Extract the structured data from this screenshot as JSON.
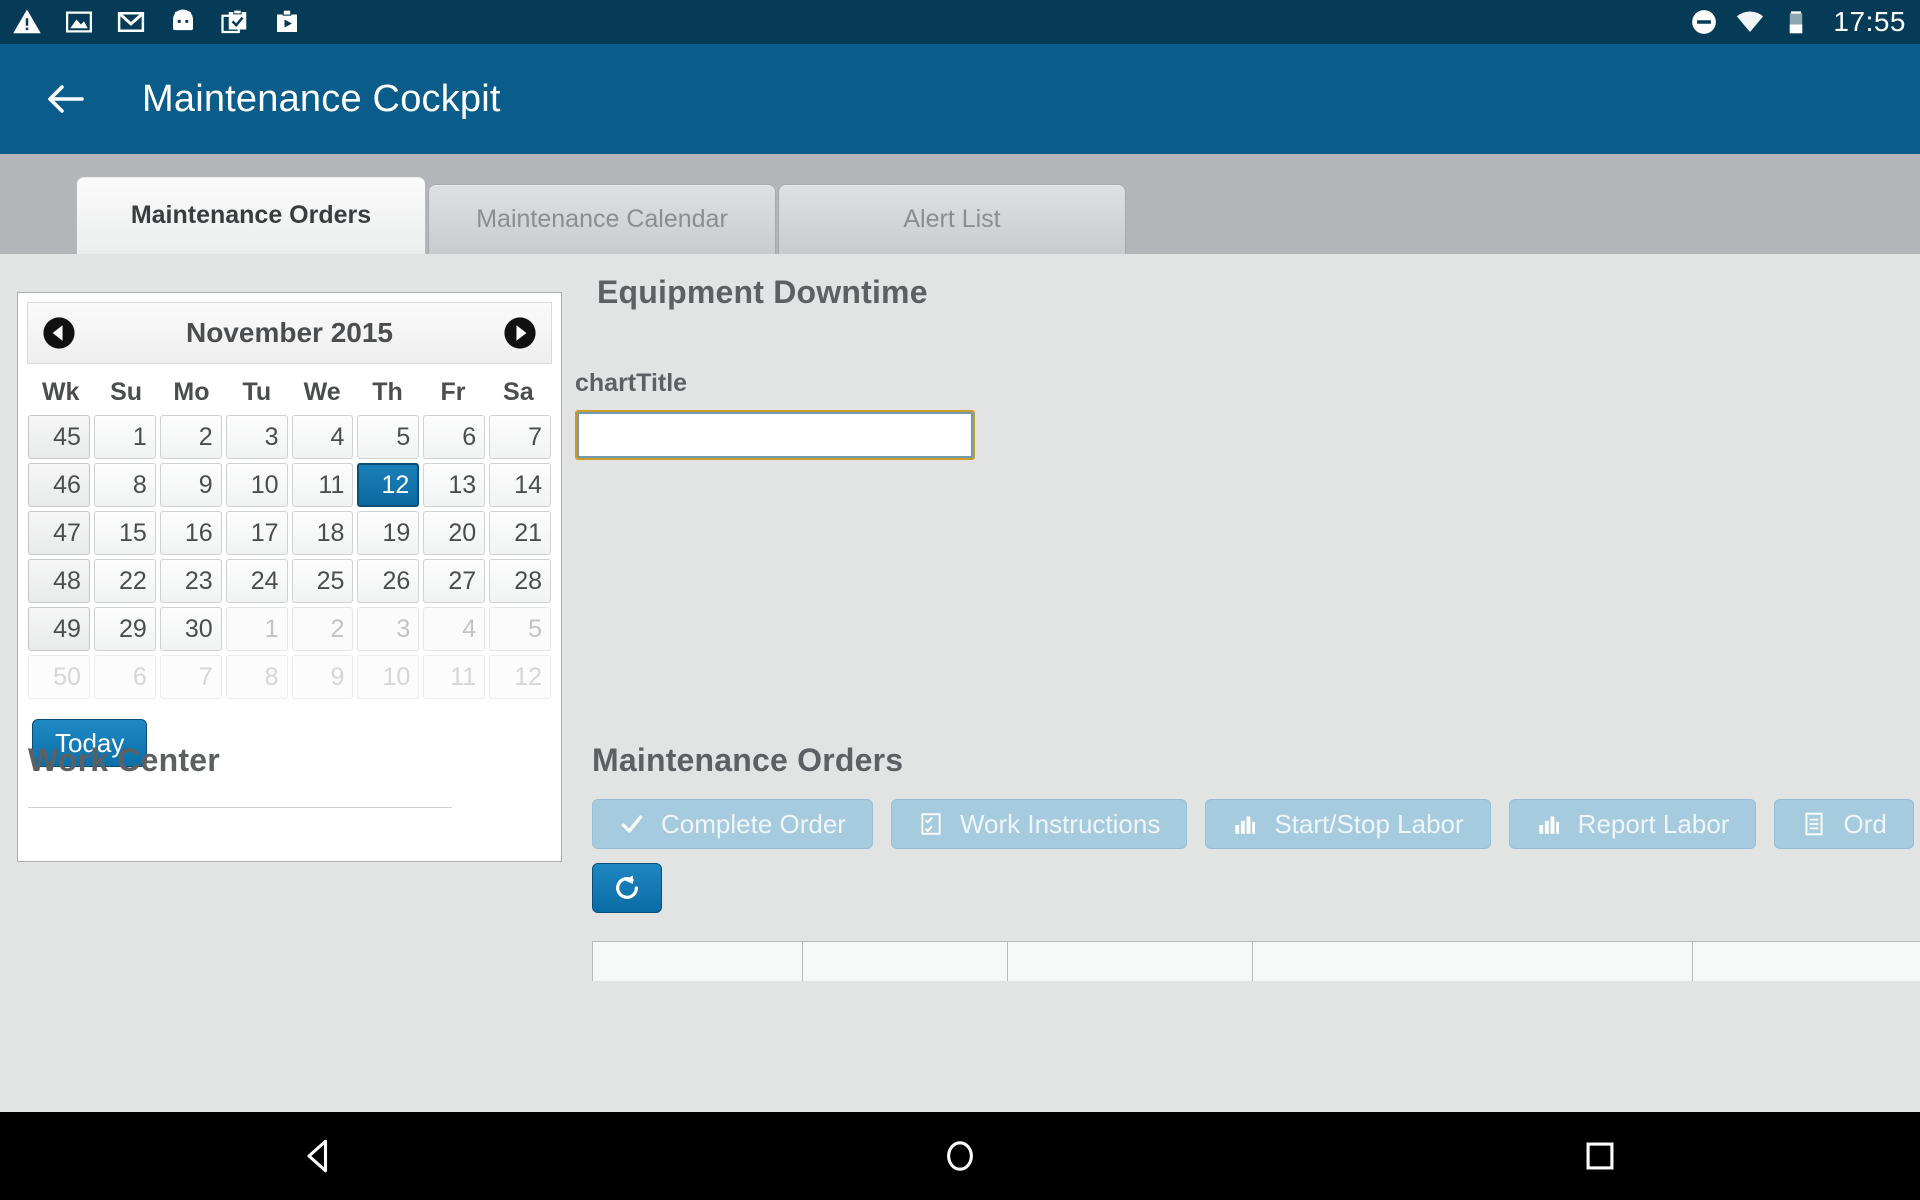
{
  "statusbar": {
    "time": "17:55",
    "left_icons": [
      "warning-triangle-icon",
      "photo-icon",
      "gmail-icon",
      "android-icon",
      "tasks-icon",
      "play-store-icon"
    ],
    "right_icons": [
      "do-not-disturb-icon",
      "wifi-icon",
      "battery-icon"
    ]
  },
  "appbar": {
    "back_icon": "back-arrow-icon",
    "title": "Maintenance Cockpit",
    "bg_color": "#0a5c8a"
  },
  "tabs": [
    {
      "label": "Maintenance Orders",
      "active": true
    },
    {
      "label": "Maintenance Calendar",
      "active": false
    },
    {
      "label": "Alert List",
      "active": false
    }
  ],
  "calendar": {
    "prev_icon": "chevron-left-circle-icon",
    "next_icon": "chevron-right-circle-icon",
    "month": "November 2015",
    "dow_headers": [
      "Wk",
      "Su",
      "Mo",
      "Tu",
      "We",
      "Th",
      "Fr",
      "Sa"
    ],
    "weeks": [
      {
        "wk": "45",
        "days": [
          "1",
          "2",
          "3",
          "4",
          "5",
          "6",
          "7"
        ],
        "states": [
          "in",
          "in",
          "in",
          "in",
          "in",
          "in",
          "in"
        ]
      },
      {
        "wk": "46",
        "days": [
          "8",
          "9",
          "10",
          "11",
          "12",
          "13",
          "14"
        ],
        "states": [
          "in",
          "in",
          "in",
          "in",
          "sel",
          "in",
          "in"
        ]
      },
      {
        "wk": "47",
        "days": [
          "15",
          "16",
          "17",
          "18",
          "19",
          "20",
          "21"
        ],
        "states": [
          "in",
          "in",
          "in",
          "in",
          "in",
          "in",
          "in"
        ]
      },
      {
        "wk": "48",
        "days": [
          "22",
          "23",
          "24",
          "25",
          "26",
          "27",
          "28"
        ],
        "states": [
          "in",
          "in",
          "in",
          "in",
          "in",
          "in",
          "in"
        ]
      },
      {
        "wk": "49",
        "days": [
          "29",
          "30",
          "1",
          "2",
          "3",
          "4",
          "5"
        ],
        "states": [
          "in",
          "in",
          "out",
          "out",
          "out",
          "out",
          "out"
        ]
      },
      {
        "wk": "50",
        "days": [
          "6",
          "7",
          "8",
          "9",
          "10",
          "11",
          "12"
        ],
        "states": [
          "out",
          "out",
          "out",
          "out",
          "out",
          "out",
          "out"
        ]
      }
    ],
    "selected_day": "12",
    "today_label": "Today",
    "selected_color": "#0a6ba3"
  },
  "chart_panel": {
    "title": "Equipment Downtime",
    "field_label": "chartTitle",
    "field_value": "",
    "field_placeholder": "",
    "field_border_color": "#c99b28"
  },
  "work_center": {
    "title": "Work Center"
  },
  "orders": {
    "title": "Maintenance Orders",
    "toolbar": [
      {
        "label": "Complete Order",
        "icon": "check-icon",
        "disabled": true
      },
      {
        "label": "Work Instructions",
        "icon": "checklist-icon",
        "disabled": true
      },
      {
        "label": "Start/Stop Labor",
        "icon": "bar-chart-icon",
        "disabled": true
      },
      {
        "label": "Report Labor",
        "icon": "bar-chart-icon",
        "disabled": true
      },
      {
        "label": "Ord",
        "icon": "document-icon",
        "disabled": true
      }
    ],
    "refresh_icon": "refresh-icon",
    "table_columns": [
      "",
      "",
      "",
      "",
      ""
    ]
  },
  "navbar": {
    "back_icon": "nav-back-triangle-icon",
    "home_icon": "nav-home-circle-icon",
    "recents_icon": "nav-recents-square-icon"
  }
}
